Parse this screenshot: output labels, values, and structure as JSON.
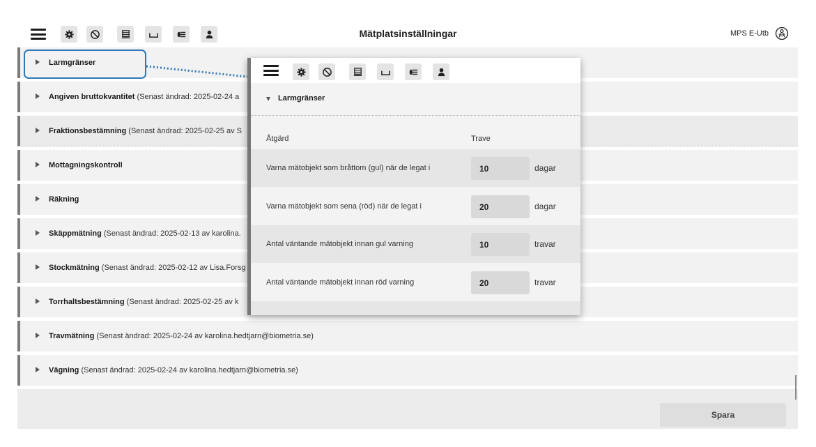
{
  "header": {
    "title": "Mätplatsinställningar",
    "user_label": "MPS E-Utb",
    "toolbar_icons": [
      "menu-icon",
      "gear-icon",
      "no-entry-icon",
      "timber-truck-icon",
      "bed-icon",
      "log-pile-icon",
      "person-icon"
    ]
  },
  "sections": [
    {
      "name": "Larmgränser",
      "meta": ""
    },
    {
      "name": "Angiven bruttokvantitet",
      "meta": " (Senast ändrad: 2025-02-24 a"
    },
    {
      "name": "Fraktionsbestämning",
      "meta": " (Senast ändrad: 2025-02-25 av S"
    },
    {
      "name": "Mottagningskontroll",
      "meta": ""
    },
    {
      "name": "Räkning",
      "meta": ""
    },
    {
      "name": "Skäppmätning",
      "meta": " (Senast ändrad: 2025-02-13 av karolina."
    },
    {
      "name": "Stockmätning",
      "meta": " (Senast ändrad: 2025-02-12 av Lisa.Forsg"
    },
    {
      "name": "Torrhaltsbestämning",
      "meta": " (Senast ändrad: 2025-02-25 av k"
    },
    {
      "name": "Travmätning",
      "meta": " (Senast ändrad: 2025-02-24 av karolina.hedtjarn@biometria.se)"
    },
    {
      "name": "Vägning",
      "meta": " (Senast ändrad: 2025-02-24 av karolina.hedtjarn@biometria.se)"
    }
  ],
  "footer": {
    "save_label": "Spara"
  },
  "panel": {
    "section_title": "Larmgränser",
    "col_action": "Åtgärd",
    "col_trave": "Trave",
    "rows": [
      {
        "label": "Varna mätobjekt som bråttom (gul) när de legat i",
        "value": "10",
        "unit": "dagar"
      },
      {
        "label": "Varna mätobjekt som sena (röd) när de legat i",
        "value": "20",
        "unit": "dagar"
      },
      {
        "label": "Antal väntande mätobjekt innan gul varning",
        "value": "10",
        "unit": "travar"
      },
      {
        "label": "Antal väntande mätobjekt innan röd varning",
        "value": "20",
        "unit": "travar"
      }
    ]
  },
  "colors": {
    "accent": "#2f78b8",
    "row_bg": "#f2f2f2",
    "row_border": "#7a7a7a"
  }
}
